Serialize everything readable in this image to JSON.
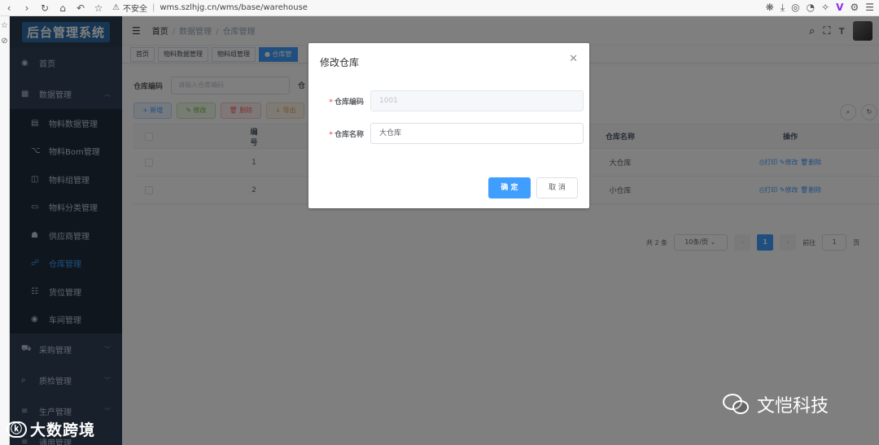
{
  "browser": {
    "security": "不安全",
    "url": "wms.szlhjg.cn/wms/base/warehouse"
  },
  "sidebar": {
    "logo": "后台管理系统",
    "items": [
      {
        "label": "首页",
        "icon": "dashboard-icon"
      },
      {
        "label": "数据管理",
        "icon": "table-icon"
      },
      {
        "label": "采购管理",
        "icon": "cart-icon"
      },
      {
        "label": "质检管理",
        "icon": "search-icon"
      },
      {
        "label": "生产管理",
        "icon": "list-icon"
      },
      {
        "label": "通用管理",
        "icon": "list-icon"
      }
    ],
    "sub_items": [
      {
        "label": "物料数据管理",
        "icon": "document-icon"
      },
      {
        "label": "物料Bom管理",
        "icon": "tree-icon"
      },
      {
        "label": "物料组管理",
        "icon": "box-icon"
      },
      {
        "label": "物料分类管理",
        "icon": "tag-icon"
      },
      {
        "label": "供应商管理",
        "icon": "user-icon"
      },
      {
        "label": "仓库管理",
        "icon": "org-icon"
      },
      {
        "label": "货位管理",
        "icon": "list-icon"
      },
      {
        "label": "车间管理",
        "icon": "circle-icon"
      }
    ]
  },
  "navbar": {
    "breadcrumb": [
      "首页",
      "数据管理",
      "仓库管理"
    ]
  },
  "tags": [
    "首页",
    "物料数据管理",
    "物料组管理",
    "● 仓库管"
  ],
  "search": {
    "label": "仓库编码",
    "placeholder": "请输入仓库编码",
    "label2": "仓"
  },
  "toolbar": {
    "add": "+ 新增",
    "edit": "✎ 修改",
    "delete": "🗑 删除",
    "export": "↓ 导出"
  },
  "table": {
    "headers": {
      "id": "编号",
      "name": "仓库名称",
      "ops": "操作"
    },
    "rows": [
      {
        "id": "1",
        "name": "大仓库"
      },
      {
        "id": "2",
        "name": "小仓库"
      }
    ],
    "ops": "⎙打印  ✎修改  🗑删除"
  },
  "pagination": {
    "total": "共 2 条",
    "page_size": "10条/页",
    "current": "1",
    "goto_label": "前往",
    "goto_value": "1",
    "page_unit": "页"
  },
  "dialog": {
    "title": "修改仓库",
    "fields": [
      {
        "label": "仓库编码",
        "value": "1001"
      },
      {
        "label": "仓库名称",
        "value": "大仓库"
      }
    ],
    "confirm": "确 定",
    "cancel": "取 消"
  },
  "watermarks": {
    "left": "大数跨境",
    "right": "文恺科技"
  },
  "colors": {
    "sidebar_bg": "#304156",
    "primary": "#409eff",
    "required": "#f56c6c"
  }
}
